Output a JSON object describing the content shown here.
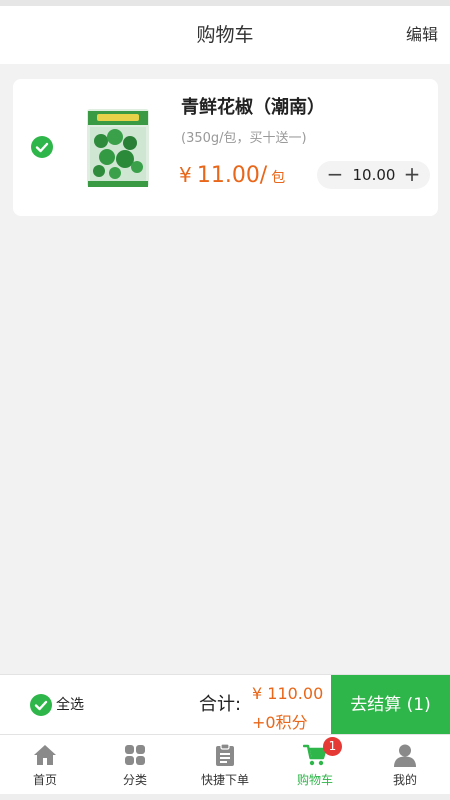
{
  "header": {
    "title": "购物车",
    "edit_label": "编辑"
  },
  "cart": {
    "items": [
      {
        "name": "青鲜花椒（潮南）",
        "spec": "(350g/包，买十送一)",
        "price_symbol": "¥",
        "price": "11.00/",
        "unit": "包",
        "quantity": "10.00",
        "selected": true
      }
    ]
  },
  "checkout": {
    "select_all_label": "全选",
    "total_label": "合计:",
    "total_amount": "¥ 110.00",
    "points": "+0积分",
    "button_label": "去结算 (1)"
  },
  "tabbar": {
    "items": [
      {
        "label": "首页",
        "icon": "home-icon",
        "active": false
      },
      {
        "label": "分类",
        "icon": "category-icon",
        "active": false
      },
      {
        "label": "快捷下单",
        "icon": "clipboard-icon",
        "active": false
      },
      {
        "label": "购物车",
        "icon": "cart-icon",
        "active": true,
        "badge": "1"
      },
      {
        "label": "我的",
        "icon": "user-icon",
        "active": false
      }
    ]
  },
  "colors": {
    "accent": "#2fb64a",
    "price": "#e8671a",
    "badge": "#e53935"
  }
}
